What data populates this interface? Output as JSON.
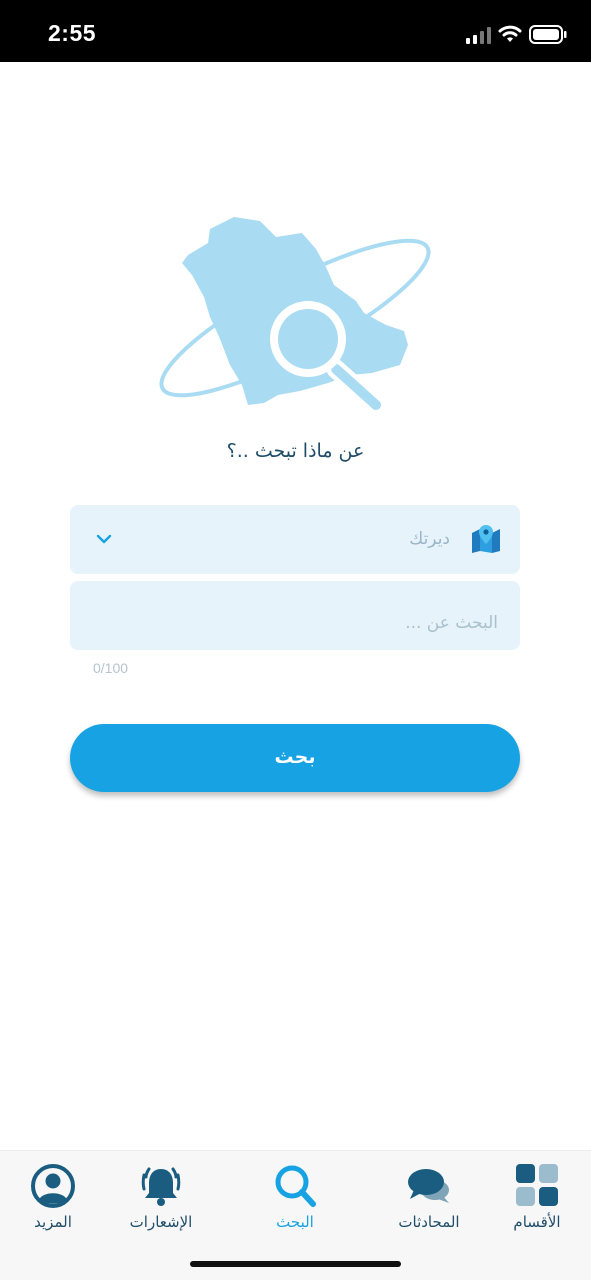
{
  "status_bar": {
    "time": "2:55"
  },
  "hero": {
    "question": "عن ماذا تبحث ..؟"
  },
  "form": {
    "city_placeholder": "ديرتك",
    "query_placeholder": "البحث عن ...",
    "query_value": "",
    "counter": "0/100",
    "submit_label": "بحث"
  },
  "tabs": [
    {
      "label": "المزيد",
      "icon": "profile-icon",
      "active": false
    },
    {
      "label": "الإشعارات",
      "icon": "bell-icon",
      "active": false
    },
    {
      "label": "البحث",
      "icon": "search-icon",
      "active": true
    },
    {
      "label": "المحادثات",
      "icon": "chat-icon",
      "active": false
    },
    {
      "label": "الأقسام",
      "icon": "grid-icon",
      "active": false
    }
  ],
  "colors": {
    "accent": "#17a3e3",
    "dark": "#1f4e6a",
    "field_bg": "#e6f3fb",
    "map_blue": "#a9dcf3"
  }
}
